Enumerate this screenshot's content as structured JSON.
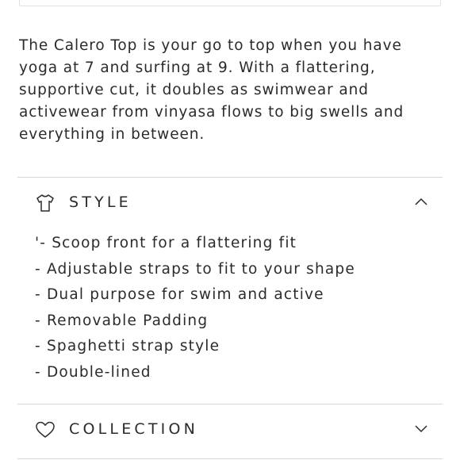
{
  "description": "The Calero Top is your go to top when you have yoga at 7 and surfing at 9. With a flattering, supportive cut, it doubles as swimwear and activewear from vinyasa flows to big swells and everything in between.",
  "sections": {
    "style": {
      "title": "STYLE",
      "icon": "tshirt-icon",
      "expanded": true,
      "items": [
        "'- Scoop front for a flattering fit",
        "- Adjustable straps to fit to your shape",
        "- Dual purpose for swim and active",
        "- Removable Padding",
        "- Spaghetti strap style",
        "- Double-lined"
      ]
    },
    "collection": {
      "title": "COLLECTION",
      "icon": "heart-icon",
      "expanded": false
    }
  }
}
